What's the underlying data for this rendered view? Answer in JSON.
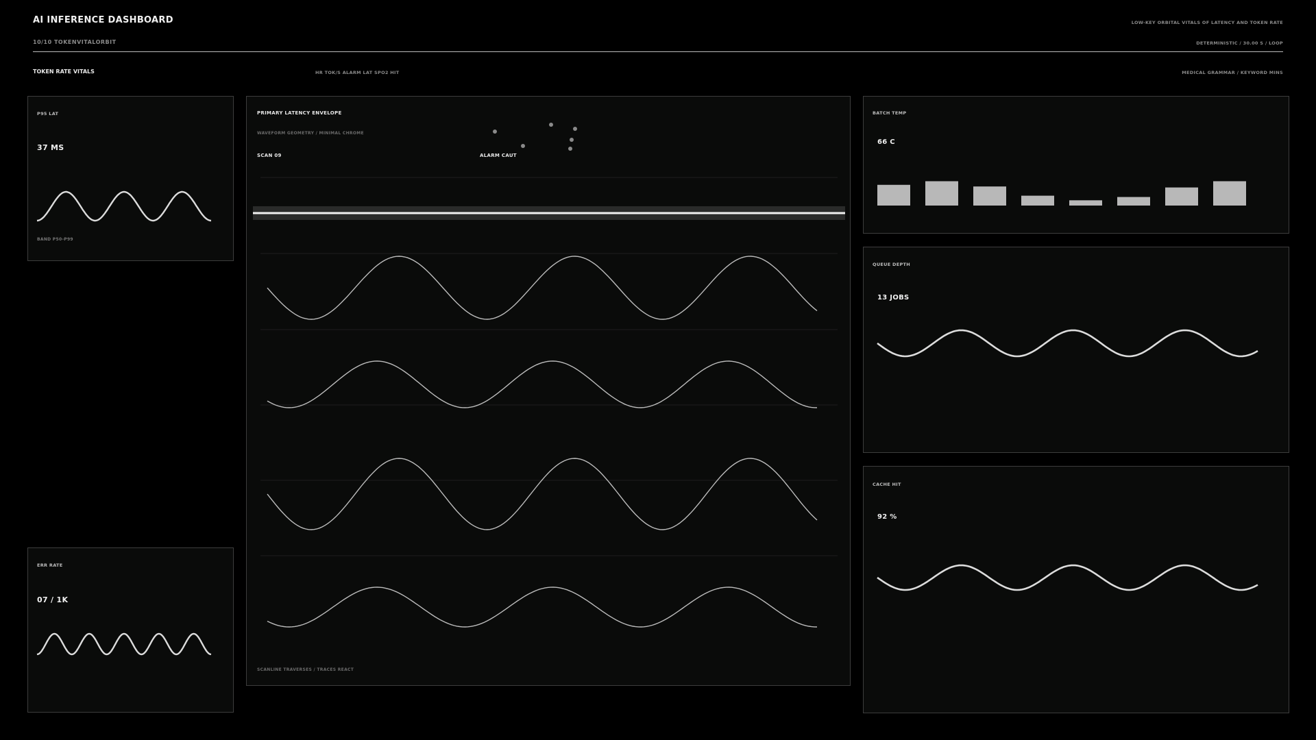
{
  "header": {
    "title": "AI INFERENCE DASHBOARD",
    "subtitle": "10/10  TOKENVITALORBIT",
    "tagline": "LOW-KEY ORBITAL VITALS OF LATENCY AND TOKEN RATE",
    "mode": "DETERMINISTIC / 30.00 S / LOOP"
  },
  "section": {
    "title": "TOKEN RATE VITALS",
    "legend": "HR TOK/S  ALARM LAT  SPO2 HIT",
    "grammar": "MEDICAL GRAMMAR / KEYWORD MINS"
  },
  "panels": {
    "p95": {
      "label": "P95 LAT",
      "value": "37 MS",
      "footer": "BAND P50-P99"
    },
    "err": {
      "label": "ERR RATE",
      "value": "07 / 1K"
    },
    "primary": {
      "label": "PRIMARY  LATENCY ENVELOPE",
      "sublabel": "WAVEFORM GEOMETRY / MINIMAL CHROME",
      "scan": "SCAN 09",
      "alarm": "ALARM CAUT",
      "footer": "SCANLINE TRAVERSES / TRACES REACT"
    },
    "batch": {
      "label": "BATCH TEMP",
      "value": "66 C",
      "bars": [
        0.63,
        0.74,
        0.58,
        0.3,
        0.16,
        0.26,
        0.55,
        0.74
      ]
    },
    "queue": {
      "label": "QUEUE DEPTH",
      "value": "13 JOBS"
    },
    "cache": {
      "label": "CACHE HIT",
      "value": "92 %"
    }
  },
  "colors": {
    "background": "#000000",
    "panel": "#0a0b0a",
    "border": "#3d3d3d",
    "trace": "#dcdcdc",
    "bar": "#b8b8b8"
  }
}
